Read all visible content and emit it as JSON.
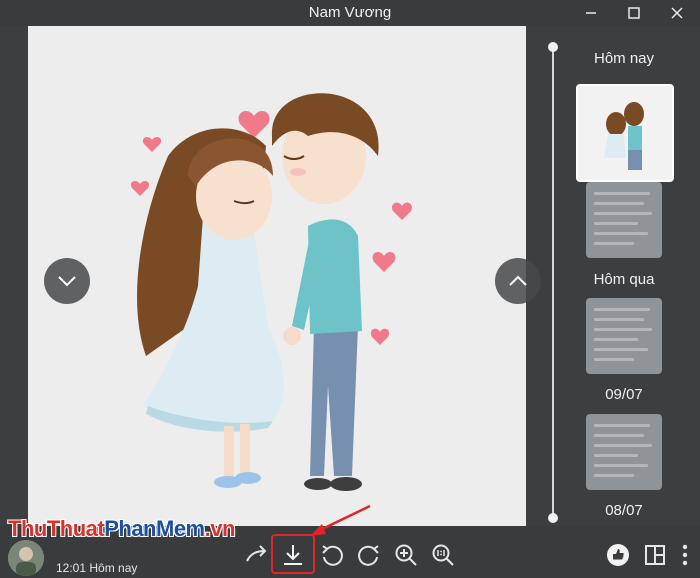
{
  "window": {
    "title": "Nam Vương"
  },
  "watermark": {
    "part1": "ThuThuat",
    "part2": "PhanMem",
    "part3": ".vn"
  },
  "sidebar": {
    "groups": [
      {
        "label": "Hôm nay"
      },
      {
        "label": "Hôm qua"
      },
      {
        "label": "09/07"
      },
      {
        "label": "08/07"
      }
    ]
  },
  "footer": {
    "timestamp": "12:01 Hôm nay"
  },
  "icons": {
    "minimize": "minimize-icon",
    "maximize": "maximize-icon",
    "close": "close-icon",
    "prev": "chevron-down-icon",
    "next": "chevron-up-icon",
    "forward": "forward-icon",
    "download": "download-icon",
    "rotate_left": "rotate-left-icon",
    "rotate_right": "rotate-right-icon",
    "zoom_in": "zoom-in-icon",
    "actual_size": "actual-size-icon",
    "like": "thumbs-up-icon",
    "layout": "layout-icon",
    "more": "more-icon"
  },
  "colors": {
    "highlight": "#e3242b",
    "background": "#3d3e40",
    "viewer_bg": "#ededed"
  }
}
